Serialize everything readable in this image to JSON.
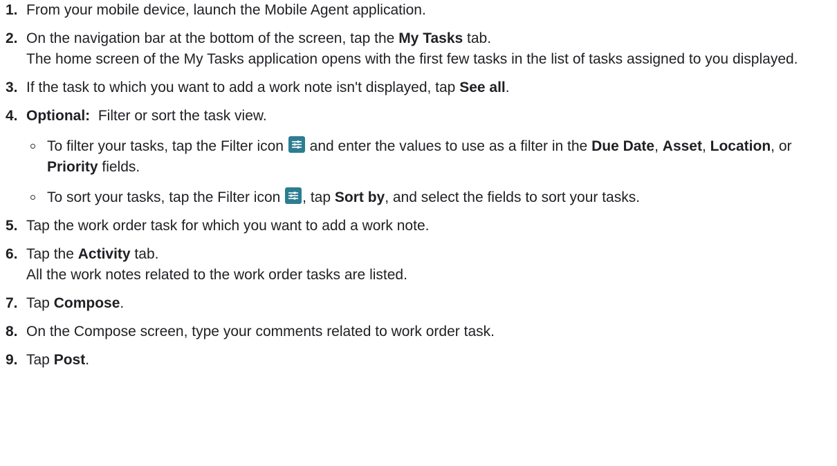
{
  "steps": [
    {
      "num": "1.",
      "text": "From your mobile device, launch the Mobile Agent application."
    },
    {
      "num": "2.",
      "pre": "On the navigation bar at the bottom of the screen, tap the ",
      "bold": "My Tasks",
      "post": " tab.",
      "result": "The home screen of the My Tasks application opens with the first few tasks in the list of tasks assigned to you displayed."
    },
    {
      "num": "3.",
      "pre": "If the task to which you want to add a work note isn't displayed, tap ",
      "bold": "See all",
      "post": "."
    },
    {
      "num": "4.",
      "bold": "Optional:",
      "post": "  Filter or sort the task view.",
      "sub": [
        {
          "pre": "To filter your tasks, tap the Filter icon",
          "mid": " and enter the values to use as a filter in the ",
          "b1": "Due Date",
          "s1": ", ",
          "b2": "Asset",
          "s2": ", ",
          "b3": "Location",
          "s3": ", or ",
          "b4": "Priority",
          "end": " fields."
        },
        {
          "pre": "To sort your tasks, tap the Filter icon",
          "mid": ", tap ",
          "b1": "Sort by",
          "end": ", and select the fields to sort your tasks."
        }
      ]
    },
    {
      "num": "5.",
      "text": "Tap the work order task for which you want to add a work note."
    },
    {
      "num": "6.",
      "pre": "Tap the ",
      "bold": "Activity",
      "post": " tab.",
      "result": "All the work notes related to the work order tasks are listed."
    },
    {
      "num": "7.",
      "pre": "Tap ",
      "bold": "Compose",
      "post": "."
    },
    {
      "num": "8.",
      "text": "On the Compose screen, type your comments related to work order task."
    },
    {
      "num": "9.",
      "pre": "Tap ",
      "bold": "Post",
      "post": "."
    }
  ],
  "icons": {
    "filter": "filter-icon",
    "filter_color": "#2d7d92"
  }
}
